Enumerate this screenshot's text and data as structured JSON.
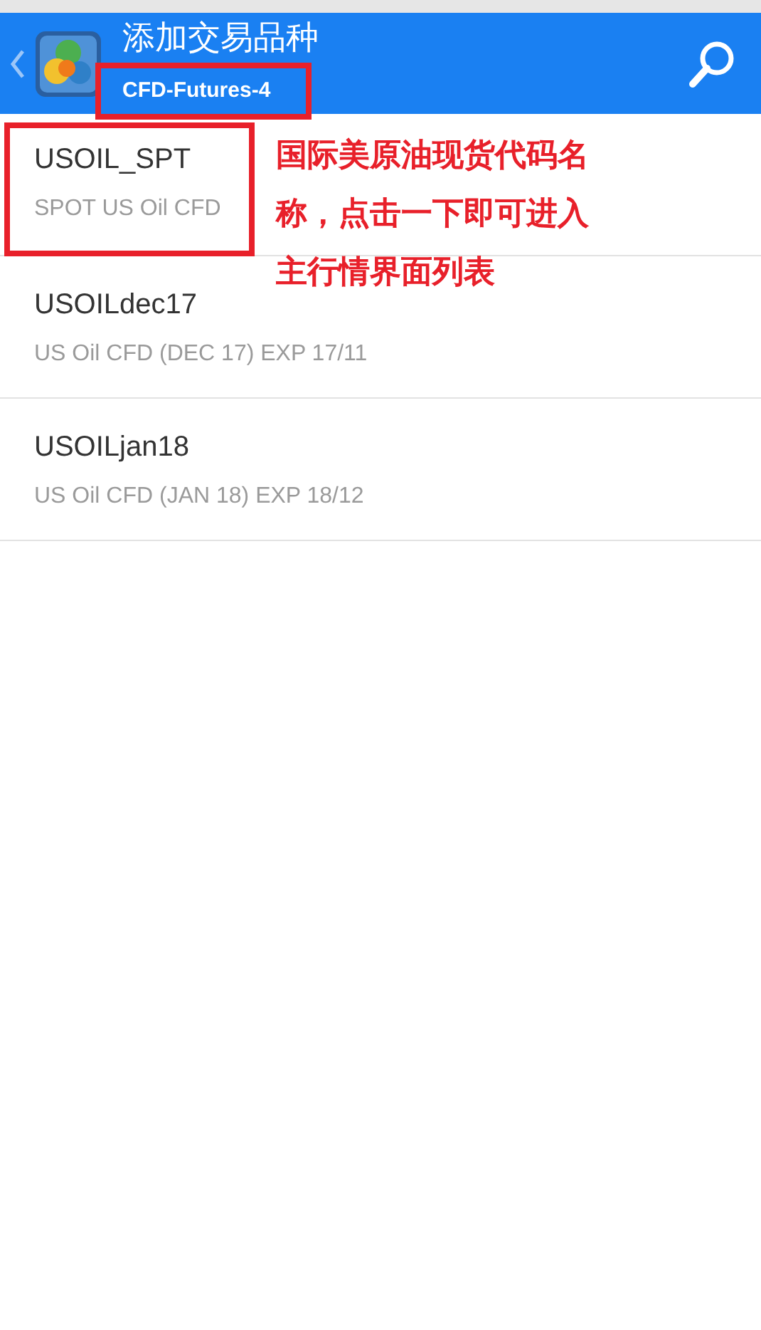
{
  "header": {
    "title": "添加交易品种",
    "subtitle": "CFD-Futures-4",
    "subtitle_highlighted": true
  },
  "symbols": [
    {
      "symbol": "USOIL_SPT",
      "description": "SPOT US Oil CFD",
      "highlighted": true
    },
    {
      "symbol": "USOILdec17",
      "description": "US Oil CFD (DEC 17) EXP 17/11",
      "highlighted": false
    },
    {
      "symbol": "USOILjan18",
      "description": "US Oil CFD (JAN 18) EXP 18/12",
      "highlighted": false
    }
  ],
  "annotation": {
    "text": "国际美原油现货代码名称，点击一下即可进入主行情界面列表"
  }
}
